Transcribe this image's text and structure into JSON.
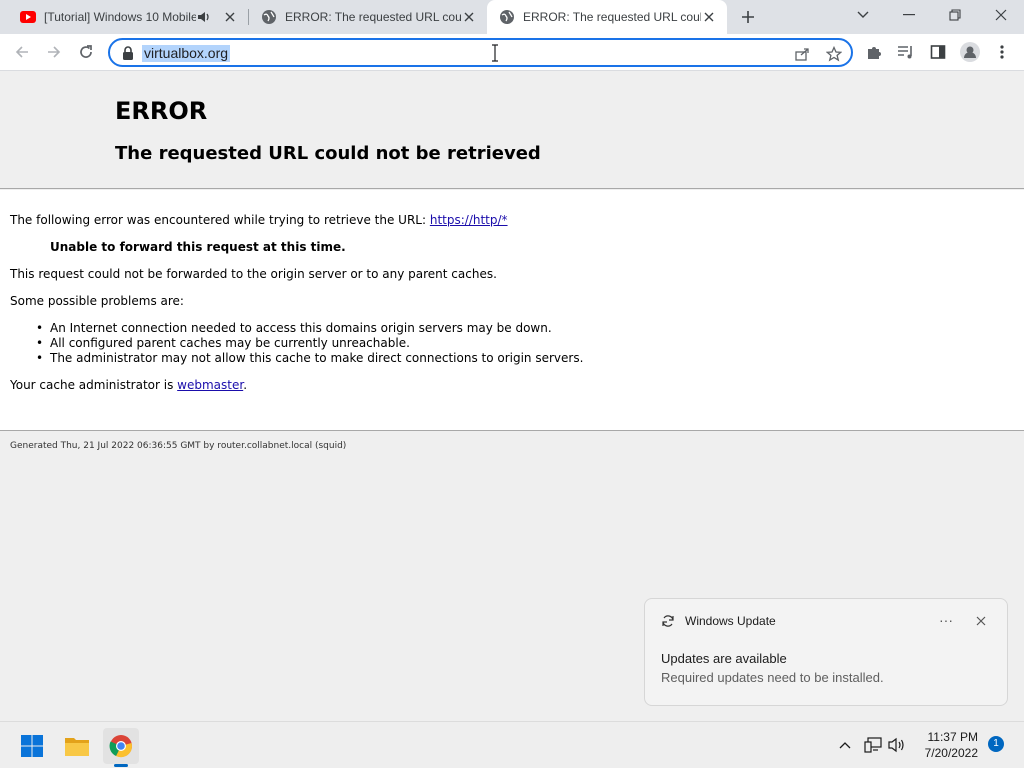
{
  "tabs": [
    {
      "title": "[Tutorial] Windows 10 Mobile",
      "favicon": "youtube-icon",
      "muted_icon": "speaker-icon",
      "active": false
    },
    {
      "title": "ERROR: The requested URL could not be retrieved",
      "favicon": "globe-icon",
      "active": false
    },
    {
      "title": "ERROR: The requested URL could not be retrieved",
      "favicon": "globe-icon",
      "active": true
    }
  ],
  "toolbar": {
    "url": "virtualbox.org"
  },
  "page": {
    "title": "ERROR",
    "subtitle": "The requested URL could not be retrieved",
    "intro": "The following error was encountered while trying to retrieve the URL:",
    "intro_link": "https://http/*",
    "error_message": "Unable to forward this request at this time.",
    "detail": "This request could not be forwarded to the origin server or to any parent caches.",
    "problems_heading": "Some possible problems are:",
    "problems": [
      "An Internet connection needed to access this domains origin servers may be down.",
      "All configured parent caches may be currently unreachable.",
      "The administrator may not allow this cache to make direct connections to origin servers."
    ],
    "admin_text": "Your cache administrator is",
    "admin_link": "webmaster",
    "admin_suffix": ".",
    "footer": "Generated Thu, 21 Jul 2022 06:36:55 GMT by router.collabnet.local (squid)"
  },
  "notification": {
    "app": "Windows Update",
    "title": "Updates are available",
    "body": "Required updates need to be installed.",
    "more": "···"
  },
  "taskbar": {
    "time": "11:37 PM",
    "date": "7/20/2022",
    "badge": "1"
  },
  "colors": {
    "accent": "#1a73e8",
    "link": "#1a0dab",
    "taskbar_accent": "#0067c0"
  }
}
